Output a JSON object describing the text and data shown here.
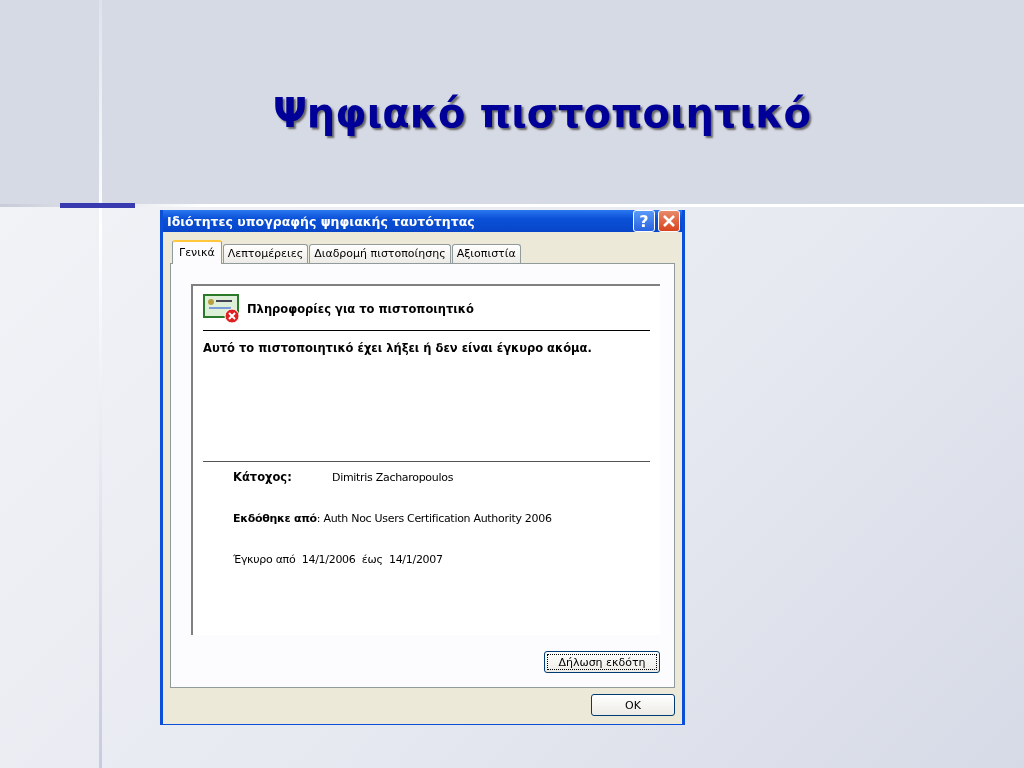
{
  "slide": {
    "title": "Ψηφιακό πιστοποιητικό"
  },
  "dialog": {
    "title": "Ιδιότητες υπογραφής ψηφιακής ταυτότητας",
    "help_button": "?",
    "tabs": [
      {
        "label": "Γενικά",
        "selected": true
      },
      {
        "label": "Λεπτομέρειες",
        "selected": false
      },
      {
        "label": "Διαδρομή πιστοποίησης",
        "selected": false
      },
      {
        "label": "Αξιοπιστία",
        "selected": false
      }
    ],
    "info_heading": "Πληροφορίες για το πιστοποιητικό",
    "message": "Αυτό το πιστοποιητικό έχει λήξει ή δεν είναι έγκυρο ακόμα.",
    "fields": [
      {
        "kind": "tabbed",
        "label": "Κάτοχος:",
        "value": "Dimitris Zacharopoulos"
      },
      {
        "kind": "inline",
        "text": "**Εκδόθηκε από**: Auth Noc Users Certification Authority 2006"
      },
      {
        "kind": "inline",
        "text": "Έγκυρο από  14/1/2006  έως  14/1/2007"
      }
    ],
    "issuer_button": "Δήλωση εκδότη",
    "buttons": [
      "OK"
    ]
  }
}
